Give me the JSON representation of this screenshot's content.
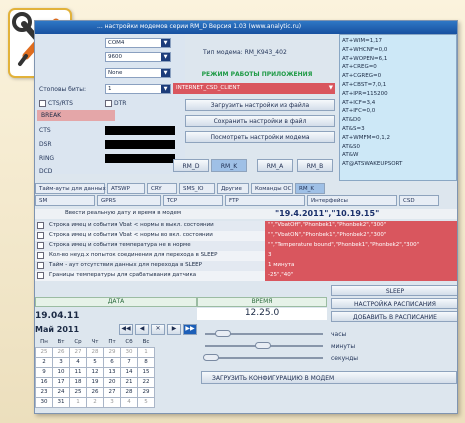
{
  "window": {
    "title": "... настройки модемов серии RM_D    Версия 1.03    (www.analytic.ru)"
  },
  "port": {
    "labels": [
      "Стоповы биты:"
    ],
    "values": [
      "COM4",
      "9600",
      "None",
      "1"
    ]
  },
  "flow": {
    "cts_label": "CTS/RTS",
    "dtr_label": "DTR",
    "break_label": "BREAK"
  },
  "signals": [
    "CTS",
    "DSR",
    "RING",
    "DCD"
  ],
  "modem": {
    "type_label": "Тип модема:",
    "type_value": "RM_K943_402",
    "mode_title": "РЕЖИМ РАБОТЫ ПРИЛОЖЕНИЯ",
    "mode_value": "INTERNET_CSD_CLIENT"
  },
  "actions": {
    "load": "Загрузить настройки из файла",
    "save": "Сохранить настройки в файл",
    "view": "Посмотреть настройки модема"
  },
  "modem_tabs": [
    "RM_D",
    "RM_K",
    "RM_A",
    "RM_B"
  ],
  "at_log": [
    "AT+WIM=1,17",
    "AT+WHCNF=0,0",
    "AT+WOPEN=6,1",
    "AT+CREG=0",
    "AT+CGREG=0",
    "AT+CBST=7,0,1",
    "AT+IPR=115200",
    "AT+ICF=3,4",
    "AT+IFC=0,0",
    "AT&D0",
    "AT&S=3",
    "AT+WMFM=0,1,2",
    "AT&S0",
    "AT&W",
    "AT@ATSWAKEUPSORT"
  ],
  "tabs1": [
    "Тайм-ауты для данных",
    "ATSWP",
    "CRY",
    "SMS_IO",
    "Другие",
    "Команды ОС",
    "RM_K"
  ],
  "tabs2": [
    "SM",
    "GPRS",
    "TCP",
    "FTP",
    "Интерфейсы",
    "CSD"
  ],
  "date_row": {
    "label": "Ввести реальную дату и время в модем",
    "value": "\"19.4.2011\",\"10.19.15\""
  },
  "params": [
    {
      "t": "Строка имец и события Vbat < нормы в выкл. состоянии",
      "v": "\"\",\"VbatOff\",\"Phonbek1\",\"Phonbek2\",\"300\""
    },
    {
      "t": "Строка имец и события Vbat < нормы во вкл. состоянии",
      "v": "\"\",\"VbatON\",\"Phonbek1\",\"Phonbek2\",\"300\""
    },
    {
      "t": "Строка имец и события температура не в норме",
      "v": "\"\",\"Temperature bound\",\"Phonbek1\",\"Phonbek2\",\"300\""
    },
    {
      "t": "Кол-во неуд.х попыток соединения для перехода в SLEEP",
      "v": "3"
    },
    {
      "t": "Тайм - аут отсутствия данных для перехода в SLEEP",
      "v": "1 минута"
    },
    {
      "t": "Границы температуры для срабатывания датчика",
      "v": "-25\",\"40\""
    }
  ],
  "date": {
    "label": "ДАТА",
    "value": "19.04.11"
  },
  "time": {
    "label": "ВРЕМЯ",
    "value": "12.25.0"
  },
  "calendar": {
    "month": "Май 2011",
    "days": [
      "Пн",
      "Вт",
      "Ср",
      "Чт",
      "Пт",
      "Сб",
      "Вс"
    ],
    "weeks": [
      [
        "25",
        "26",
        "27",
        "28",
        "29",
        "30",
        "1"
      ],
      [
        "2",
        "3",
        "4",
        "5",
        "6",
        "7",
        "8"
      ],
      [
        "9",
        "10",
        "11",
        "12",
        "13",
        "14",
        "15"
      ],
      [
        "16",
        "17",
        "18",
        "19",
        "20",
        "21",
        "22"
      ],
      [
        "23",
        "24",
        "25",
        "26",
        "27",
        "28",
        "29"
      ],
      [
        "30",
        "31",
        "1",
        "2",
        "3",
        "4",
        "5"
      ]
    ]
  },
  "sliders": {
    "hours": "часы",
    "minutes": "минуты",
    "seconds": "секунды"
  },
  "schedule": {
    "sleep": "SLEEP",
    "settings": "НАСТРОЙКА РАСПИСАНИЯ",
    "add": "ДОБАВИТЬ В РАСПИСАНИЕ"
  },
  "upload": "ЗАГРУЗИТЬ КОНФИГУРАЦИЮ В МОДЕМ",
  "colors": {
    "accent": "#1750a0",
    "error": "#d9565e",
    "mode": "#1e9a45"
  }
}
